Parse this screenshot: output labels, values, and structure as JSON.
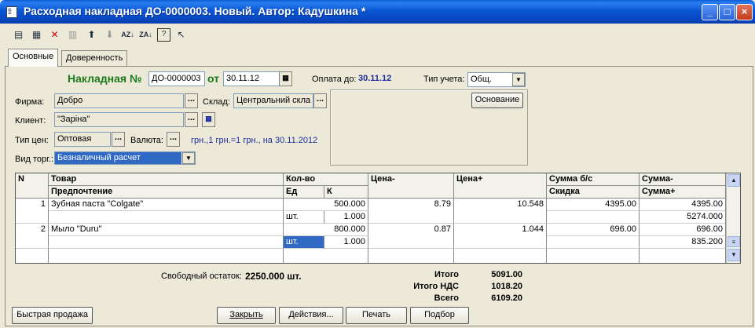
{
  "window": {
    "title": "Расходная накладная  ДО-0000003. Новый. Автор: Кадушкина *",
    "controls": [
      "_",
      "□",
      "×"
    ]
  },
  "toolbar_icons": [
    "new-row-icon",
    "copy-row-icon",
    "delete-row-icon",
    "edit-row-icon",
    "move-up-icon",
    "move-down-icon",
    "sort-asc-icon",
    "sort-desc-icon",
    "help-icon",
    "select-icon"
  ],
  "tabs": [
    "Основные",
    "Доверенность"
  ],
  "header": {
    "doc_label": "Накладная №",
    "doc_number": "ДО-0000003",
    "from_label": "от",
    "doc_date": "30.11.12",
    "pay_until_label": "Оплата до:",
    "pay_until_value": "30.11.12",
    "account_type_label": "Тип учета:",
    "account_type_value": "Общ."
  },
  "form": {
    "firm_label": "Фирма:",
    "firm_value": "Добро",
    "warehouse_label": "Склад:",
    "warehouse_value": "Центральний скла",
    "client_label": "Клиент:",
    "client_value": "\"Заріна\"",
    "price_type_label": "Тип цен:",
    "price_type_value": "Оптовая",
    "currency_label": "Валюта:",
    "currency_info": "грн.,1 грн.=1 грн., на 30.11.2012",
    "trade_type_label": "Вид торг.:",
    "trade_type_value": "Безналичный расчет",
    "basis_button": "Основание",
    "dots": "..."
  },
  "table": {
    "headers_row1": [
      "N",
      "Товар",
      "Кол-во",
      "",
      "Цена-",
      "Цена+",
      "Сумма б/с",
      "Сумма-"
    ],
    "headers_row2": [
      "",
      "Предпочтение",
      "Ед",
      "К",
      "",
      "",
      "Скидка",
      "Сумма+"
    ],
    "rows": [
      {
        "n": "1",
        "product": "Зубная паста \"Colgate\"",
        "qty": "500.000",
        "price_minus": "8.79",
        "price_plus": "10.548",
        "sum_bs": "4395.00",
        "sum_minus": "4395.00",
        "unit": "шт.",
        "k": "1.000",
        "sum_plus": "5274.000"
      },
      {
        "n": "2",
        "product": "Мыло \"Duru\"",
        "qty": "800.000",
        "price_minus": "0.87",
        "price_plus": "1.044",
        "sum_bs": "696.00",
        "sum_minus": "696.00",
        "unit": "шт.",
        "k": "1.000",
        "sum_plus": "835.200"
      }
    ]
  },
  "footer": {
    "free_stock_label": "Свободный остаток:",
    "free_stock_value": "2250.000 шт.",
    "total_label": "Итого",
    "total_value": "5091.00",
    "vat_label": "Итого НДС",
    "vat_value": "1018.20",
    "grand_label": "Всего",
    "grand_value": "6109.20"
  },
  "buttons": {
    "quick_sale": "Быстрая продажа",
    "close": "Закрыть",
    "actions": "Действия...",
    "print": "Печать",
    "select": "Подбор"
  },
  "colors": {
    "titlebar": "#0a58d8",
    "doc_label": "#1a7a1a",
    "link_blue": "#1c2c9a",
    "selection": "#316ac5"
  }
}
